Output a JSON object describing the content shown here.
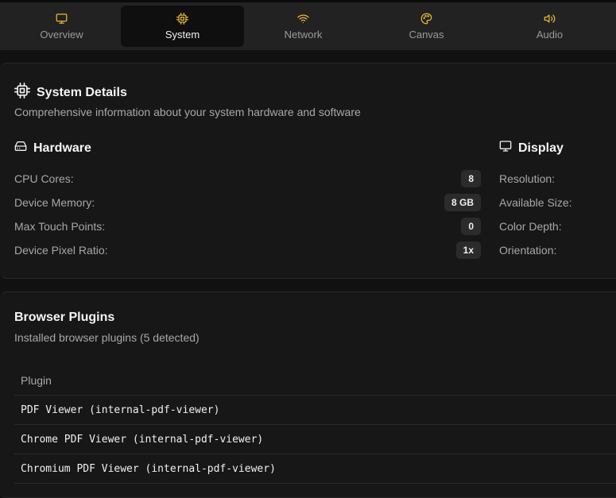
{
  "tabs": [
    {
      "label": "Overview",
      "icon": "monitor-icon",
      "active": false
    },
    {
      "label": "System",
      "icon": "cpu-icon",
      "active": true
    },
    {
      "label": "Network",
      "icon": "wifi-icon",
      "active": false
    },
    {
      "label": "Canvas",
      "icon": "palette-icon",
      "active": false
    },
    {
      "label": "Audio",
      "icon": "volume-icon",
      "active": false
    }
  ],
  "colors": {
    "accent": "#e8b931",
    "background": "#111111",
    "card": "#171717",
    "badge": "#2b2b2b"
  },
  "system": {
    "title": "System Details",
    "subtitle": "Comprehensive information about your system hardware and software",
    "hardware": {
      "heading": "Hardware",
      "rows": [
        {
          "label": "CPU Cores:",
          "value": "8"
        },
        {
          "label": "Device Memory:",
          "value": "8 GB"
        },
        {
          "label": "Max Touch Points:",
          "value": "0"
        },
        {
          "label": "Device Pixel Ratio:",
          "value": "1x"
        }
      ]
    },
    "display": {
      "heading": "Display",
      "rows": [
        {
          "label": "Resolution:"
        },
        {
          "label": "Available Size:"
        },
        {
          "label": "Color Depth:"
        },
        {
          "label": "Orientation:"
        }
      ]
    }
  },
  "plugins": {
    "title": "Browser Plugins",
    "subtitle": "Installed browser plugins (5 detected)",
    "column": "Plugin",
    "items": [
      "PDF Viewer (internal-pdf-viewer)",
      "Chrome PDF Viewer (internal-pdf-viewer)",
      "Chromium PDF Viewer (internal-pdf-viewer)"
    ]
  }
}
